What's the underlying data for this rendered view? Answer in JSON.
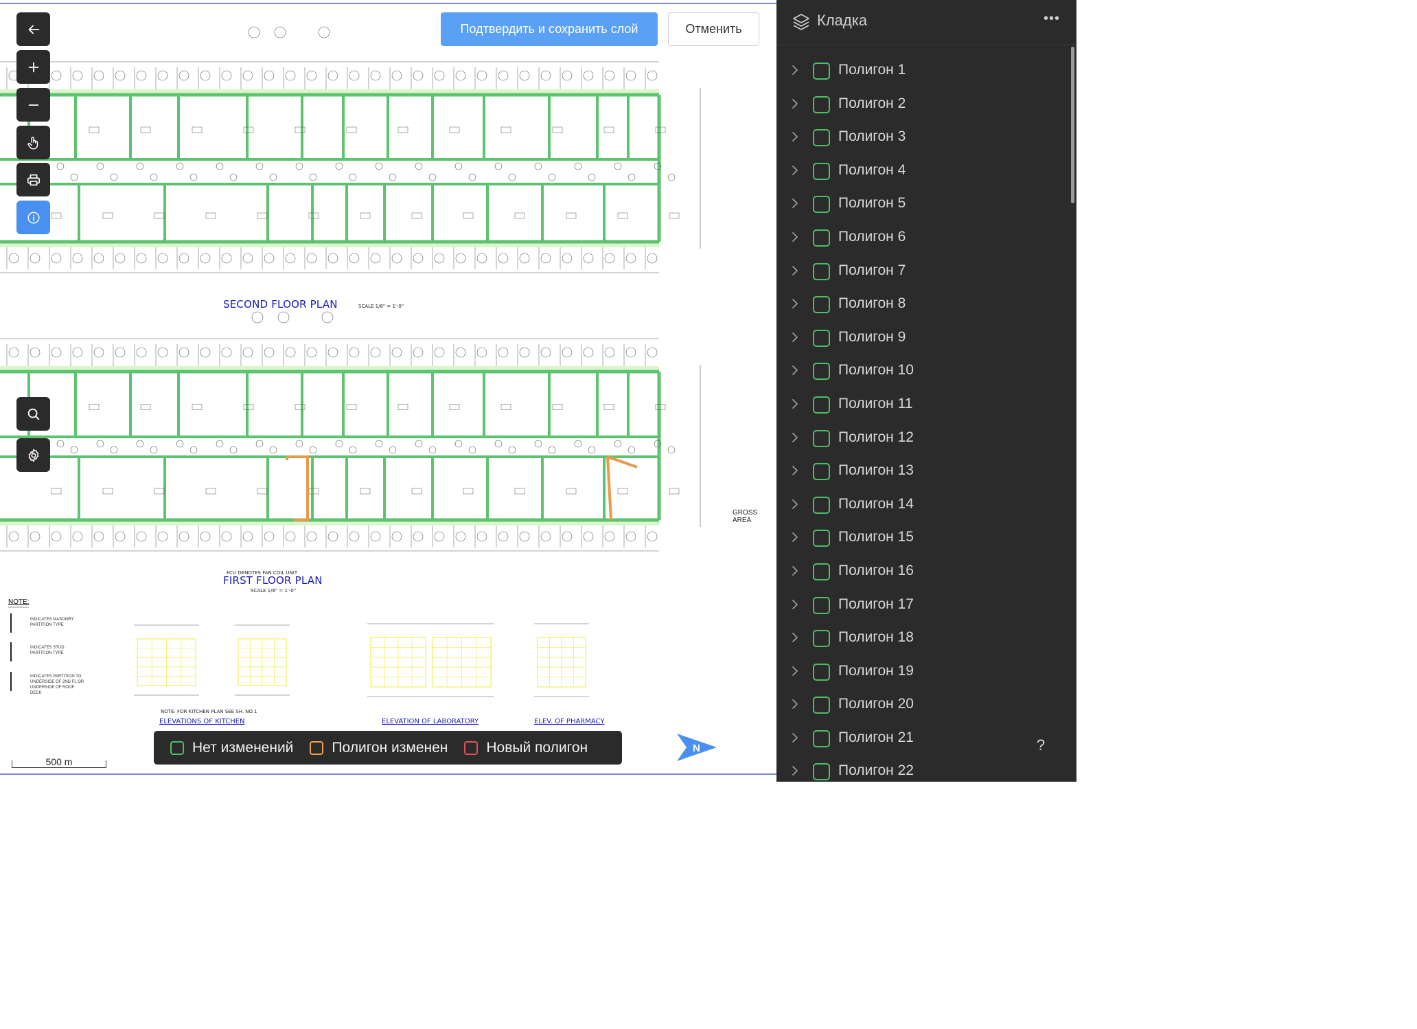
{
  "toolbar": {
    "items": [
      {
        "name": "back",
        "icon": "arrow-left-icon"
      },
      {
        "name": "zoom-in",
        "icon": "plus-icon"
      },
      {
        "name": "zoom-out",
        "icon": "minus-icon"
      },
      {
        "name": "pan",
        "icon": "hand-pointer-icon"
      },
      {
        "name": "print",
        "icon": "printer-icon"
      },
      {
        "name": "info",
        "icon": "info-icon",
        "active": true
      },
      {
        "name": "search",
        "icon": "search-icon"
      },
      {
        "name": "settings",
        "icon": "gear-icon"
      }
    ],
    "active_color": "#4a90f0",
    "background_color": "#2b2b2b"
  },
  "actions": {
    "confirm_label": "Подтвердить и сохранить слой",
    "cancel_label": "Отменить",
    "confirm_color": "#5aa0f5"
  },
  "legend": {
    "items": [
      {
        "label": "Нет изменений",
        "color": "#4bbf65"
      },
      {
        "label": "Полигон изменен",
        "color": "#f0a050"
      },
      {
        "label": "Новый полигон",
        "color": "#e05060"
      }
    ]
  },
  "scale": {
    "label": "500 m"
  },
  "north_arrow": {
    "label": "N",
    "color": "#4a90f0"
  },
  "plan": {
    "second_floor_title": "SECOND FLOOR PLAN",
    "second_floor_scale": "SCALE 1/8\" = 1'-0\"",
    "first_floor_title": "FIRST FLOOR PLAN",
    "first_floor_scale": "SCALE 1/8\" = 1'-0\"",
    "fcu_note": "FCU DENOTES FAN COIL UNIT",
    "note_head": "NOTE:",
    "notes": [
      "INDICATES MASONRY PARTITION TYPE",
      "INDICATES STUD PARTITION TYPE",
      "INDICATES PARTITION TO UNDERSIDE OF 2ND FL OR UNDERSIDE OF ROOF DECK"
    ],
    "elevations": [
      "ELEVATIONS OF KITCHEN",
      "ELEVATION OF LABORATORY",
      "ELEV. OF PHARMACY"
    ],
    "kitchen_note": "NOTE: FOR KITCHEN PLAN SEE SH. NO.1",
    "gross_area": "GROSS AREA"
  },
  "panel": {
    "title": "Кладка",
    "header_icon": "layers-icon",
    "menu_icon": "more-horizontal-icon",
    "help_label": "?",
    "status_color": "#4bbf65",
    "polygons": [
      {
        "label": "Полигон 1"
      },
      {
        "label": "Полигон 2"
      },
      {
        "label": "Полигон 3"
      },
      {
        "label": "Полигон 4"
      },
      {
        "label": "Полигон 5"
      },
      {
        "label": "Полигон 6"
      },
      {
        "label": "Полигон 7"
      },
      {
        "label": "Полигон 8"
      },
      {
        "label": "Полигон 9"
      },
      {
        "label": "Полигон 10"
      },
      {
        "label": "Полигон 11"
      },
      {
        "label": "Полигон 12"
      },
      {
        "label": "Полигон 13"
      },
      {
        "label": "Полигон 14"
      },
      {
        "label": "Полигон 15"
      },
      {
        "label": "Полигон 16"
      },
      {
        "label": "Полигон 17"
      },
      {
        "label": "Полигон 18"
      },
      {
        "label": "Полигон 19"
      },
      {
        "label": "Полигон 20"
      },
      {
        "label": "Полигон 21"
      },
      {
        "label": "Полигон 22"
      }
    ]
  }
}
